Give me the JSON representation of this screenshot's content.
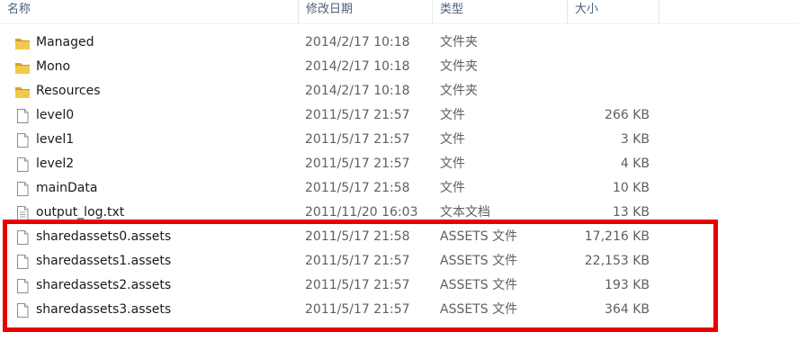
{
  "columns": {
    "name": "名称",
    "date": "修改日期",
    "type": "类型",
    "size": "大小"
  },
  "files": [
    {
      "name": "Managed",
      "date": "2014/2/17 10:18",
      "type": "文件夹",
      "size": "",
      "icon": "folder-icon"
    },
    {
      "name": "Mono",
      "date": "2014/2/17 10:18",
      "type": "文件夹",
      "size": "",
      "icon": "folder-icon"
    },
    {
      "name": "Resources",
      "date": "2014/2/17 10:18",
      "type": "文件夹",
      "size": "",
      "icon": "folder-icon"
    },
    {
      "name": "level0",
      "date": "2011/5/17 21:57",
      "type": "文件",
      "size": "266 KB",
      "icon": "file-icon"
    },
    {
      "name": "level1",
      "date": "2011/5/17 21:57",
      "type": "文件",
      "size": "3 KB",
      "icon": "file-icon"
    },
    {
      "name": "level2",
      "date": "2011/5/17 21:57",
      "type": "文件",
      "size": "4 KB",
      "icon": "file-icon"
    },
    {
      "name": "mainData",
      "date": "2011/5/17 21:58",
      "type": "文件",
      "size": "10 KB",
      "icon": "file-icon"
    },
    {
      "name": "output_log.txt",
      "date": "2011/11/20 16:03",
      "type": "文本文档",
      "size": "13 KB",
      "icon": "text-file-icon"
    },
    {
      "name": "sharedassets0.assets",
      "date": "2011/5/17 21:58",
      "type": "ASSETS 文件",
      "size": "17,216 KB",
      "icon": "file-icon"
    },
    {
      "name": "sharedassets1.assets",
      "date": "2011/5/17 21:57",
      "type": "ASSETS 文件",
      "size": "22,153 KB",
      "icon": "file-icon"
    },
    {
      "name": "sharedassets2.assets",
      "date": "2011/5/17 21:57",
      "type": "ASSETS 文件",
      "size": "193 KB",
      "icon": "file-icon"
    },
    {
      "name": "sharedassets3.assets",
      "date": "2011/5/17 21:57",
      "type": "ASSETS 文件",
      "size": "364 KB",
      "icon": "file-icon"
    }
  ],
  "colors": {
    "highlight": "#e80000",
    "folder": "#e8b73f",
    "header_text": "#4c607a"
  }
}
